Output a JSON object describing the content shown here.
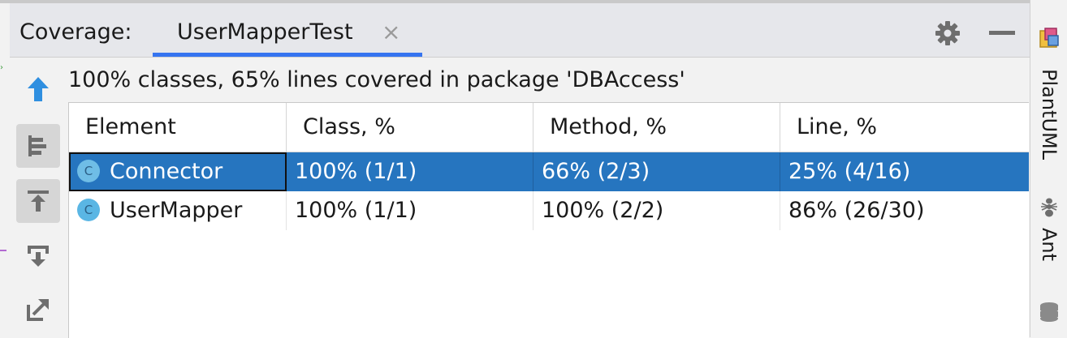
{
  "header": {
    "coverage_label": "Coverage:",
    "tab_title": "UserMapperTest",
    "tab_close": "×"
  },
  "summary": "100% classes, 65% lines covered in package 'DBAccess'",
  "table": {
    "columns": [
      "Element",
      "Class, %",
      "Method, %",
      "Line, %"
    ],
    "rows": [
      {
        "icon": "C",
        "element": "Connector",
        "class": "100% (1/1)",
        "method": "66% (2/3)",
        "line": "25% (4/16)",
        "selected": true
      },
      {
        "icon": "C",
        "element": "UserMapper",
        "class": "100% (1/1)",
        "method": "100% (2/2)",
        "line": "86% (26/30)",
        "selected": false
      }
    ]
  },
  "toolbar": {
    "icons": [
      "arrow-up-icon",
      "flatten-packages-icon",
      "navigate-to-source-icon",
      "navigate-from-source-icon",
      "export-icon"
    ]
  },
  "right_sidebar": {
    "items": [
      "PlantUML",
      "Ant"
    ]
  },
  "colors": {
    "accent": "#3574f0",
    "selection": "#2675bf",
    "class_icon": "#5ab6e4"
  }
}
